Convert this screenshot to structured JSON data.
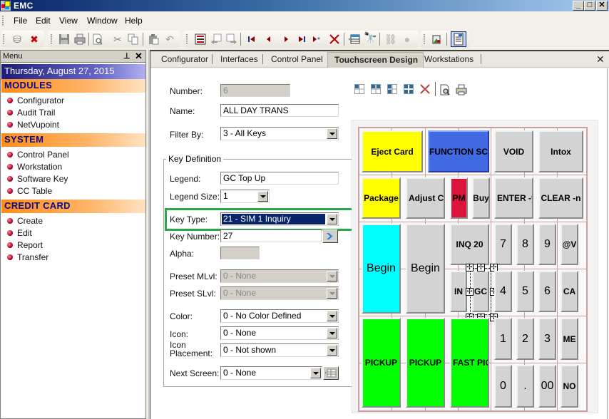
{
  "window": {
    "title": "EMC",
    "controls": {
      "minimize": "_",
      "maximize": "□",
      "close": "✕"
    }
  },
  "menubar": {
    "items": [
      "File",
      "Edit",
      "View",
      "Window",
      "Help"
    ]
  },
  "toolbar": {
    "icons": [
      "database-icon",
      "delete-database-icon",
      "save-icon",
      "print-icon",
      "print-preview-icon",
      "cut-icon",
      "copy-icon",
      "paste-icon",
      "undo-icon",
      "record-list-icon",
      "import-icon",
      "export-icon",
      "first-record-icon",
      "previous-record-icon",
      "next-record-icon",
      "last-record-icon",
      "new-record-icon",
      "delete-record-icon",
      "grid-view-icon",
      "find-icon",
      "link-icon",
      "globe-icon",
      "tools-icon",
      "properties-icon"
    ]
  },
  "menu_panel": {
    "title": "Menu",
    "pin": "pin-icon",
    "close": "close-icon",
    "date": "Thursday, August 27, 2015",
    "sections": [
      {
        "title": "MODULES",
        "items": [
          "Configurator",
          "Audit Trail",
          "NetVupoint"
        ]
      },
      {
        "title": "SYSTEM",
        "items": [
          "Control Panel",
          "Workstation",
          "Software Key",
          "CC Table"
        ]
      },
      {
        "title": "CREDIT CARD",
        "items": [
          "Create",
          "Edit",
          "Report",
          "Transfer"
        ]
      }
    ]
  },
  "tabs": {
    "items": [
      "Configurator",
      "Interfaces",
      "Control Panel",
      "Touchscreen Design",
      "Workstations"
    ],
    "active": "Touchscreen Design",
    "close": "✕"
  },
  "form": {
    "number_label": "Number:",
    "number_value": "6",
    "name_label": "Name:",
    "name_value": "ALL DAY TRANS",
    "filter_label": "Filter By:",
    "filter_value": "3 - All Keys",
    "key_definition_label": "Key Definition",
    "legend_label": "Legend:",
    "legend_value": "GC Top Up",
    "legend_size_label": "Legend Size:",
    "legend_size_value": "1",
    "key_type_label": "Key Type:",
    "key_type_value": "21 - SIM 1 Inquiry",
    "key_number_label": "Key Number:",
    "key_number_value": "27",
    "alpha_label": "Alpha:",
    "alpha_value": "",
    "preset_mlvl_label": "Preset MLvl:",
    "preset_mlvl_value": "0 - None",
    "preset_slvl_label": "Preset SLvl:",
    "preset_slvl_value": "0 - None",
    "color_label": "Color:",
    "color_value": "0 - No Color Defined",
    "icon_label": "Icon:",
    "icon_value": "0 - None",
    "icon_placement_label_1": "Icon",
    "icon_placement_label_2": "Placement:",
    "icon_placement_value": "0 - Not shown",
    "next_screen_label": "Next Screen:",
    "next_screen_value": "0 - None"
  },
  "designer_toolbar": {
    "icons": [
      "layout-top-left-icon",
      "layout-top-icon",
      "layout-left-icon",
      "layout-all-icon",
      "delete-icon",
      "print-preview-icon",
      "print-icon"
    ]
  },
  "colors": {
    "yellow": "#ffff00",
    "blue": "#4169e1",
    "gray": "#d3d3d3",
    "red": "#dc143c",
    "cyan": "#00ffff",
    "green": "#00ff00",
    "highlight_green": "#28a745",
    "selection_navy": "#0a246a"
  },
  "keys": [
    {
      "label": "Eject Card",
      "color": "#ffff00",
      "style": "bold"
    },
    {
      "label": "FUNCTION SC",
      "color": "#4169e1",
      "style": "bold"
    },
    {
      "label": "VOID",
      "color": "#d3d3d3",
      "style": "bold"
    },
    {
      "label": "Intox",
      "color": "#d3d3d3",
      "style": "bold"
    },
    {
      "label": "Package",
      "color": "#ffff00",
      "style": "bold"
    },
    {
      "label": "Adjust Clc",
      "color": "#d3d3d3",
      "style": "bold"
    },
    {
      "label": "PM",
      "color": "#dc143c",
      "style": "bold"
    },
    {
      "label": "Buy",
      "color": "#d3d3d3",
      "style": "bold"
    },
    {
      "label": "ENTER -y",
      "color": "#d3d3d3",
      "style": "bold"
    },
    {
      "label": "CLEAR -n",
      "color": "#d3d3d3",
      "style": "bold"
    },
    {
      "label": "Begin",
      "color": "#00ffff",
      "style": "big"
    },
    {
      "label": "Begin",
      "color": "#d3d3d3",
      "style": "big"
    },
    {
      "label": "INQ 20",
      "color": "#d3d3d3",
      "style": "bold"
    },
    {
      "label": "7",
      "color": "#d3d3d3",
      "style": "num"
    },
    {
      "label": "8",
      "color": "#d3d3d3",
      "style": "num"
    },
    {
      "label": "9",
      "color": "#d3d3d3",
      "style": "num"
    },
    {
      "label": "@V",
      "color": "#d3d3d3",
      "style": "bold"
    },
    {
      "label": "IN",
      "color": "#d3d3d3",
      "style": "bold"
    },
    {
      "label": "GC",
      "color": "#d3d3d3",
      "style": "bold",
      "selected": true
    },
    {
      "label": "4",
      "color": "#d3d3d3",
      "style": "num"
    },
    {
      "label": "5",
      "color": "#d3d3d3",
      "style": "num"
    },
    {
      "label": "6",
      "color": "#d3d3d3",
      "style": "num"
    },
    {
      "label": "CA",
      "color": "#d3d3d3",
      "style": "bold"
    },
    {
      "label": "PICKUP",
      "color": "#00ff00",
      "style": "bold"
    },
    {
      "label": "PICKUP",
      "color": "#00ff00",
      "style": "bold"
    },
    {
      "label": "FAST PIC",
      "color": "#00ff00",
      "style": "bold"
    },
    {
      "label": "1",
      "color": "#d3d3d3",
      "style": "num"
    },
    {
      "label": "2",
      "color": "#d3d3d3",
      "style": "num"
    },
    {
      "label": "3",
      "color": "#d3d3d3",
      "style": "num"
    },
    {
      "label": "ME",
      "color": "#d3d3d3",
      "style": "bold"
    },
    {
      "label": "0",
      "color": "#d3d3d3",
      "style": "num"
    },
    {
      "label": ".",
      "color": "#d3d3d3",
      "style": "num"
    },
    {
      "label": "00",
      "color": "#d3d3d3",
      "style": "num"
    },
    {
      "label": "NO",
      "color": "#d3d3d3",
      "style": "bold"
    }
  ]
}
